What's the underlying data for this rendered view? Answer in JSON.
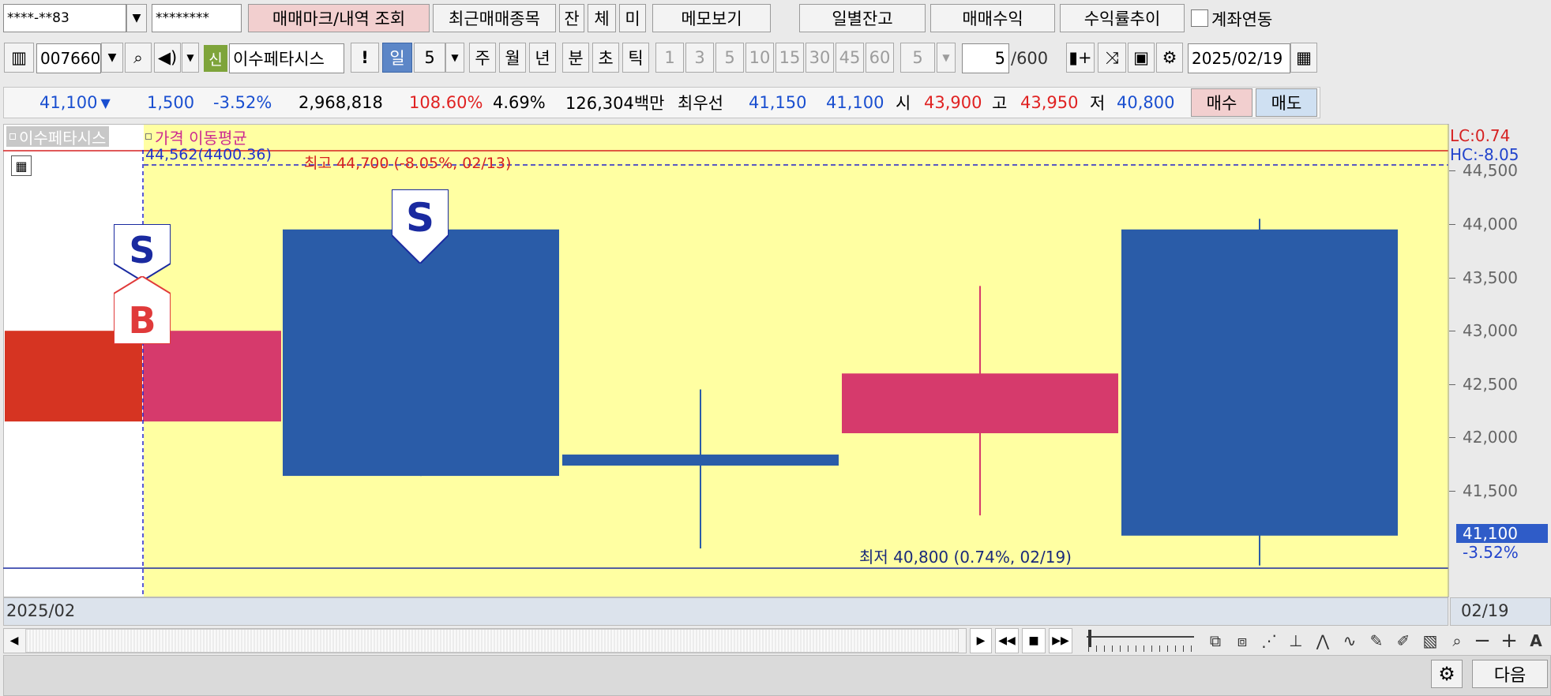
{
  "top": {
    "account": "****-**83",
    "password": "********",
    "btn_mark": "매매마크/내역 조회",
    "btn_recent": "최근매매종목",
    "btn_jan": "잔",
    "btn_che": "체",
    "btn_mi": "미",
    "btn_memo": "메모보기",
    "btn_daily": "일별잔고",
    "btn_profit": "매매수익",
    "btn_trend": "수익률추이",
    "link_label": "계좌연동"
  },
  "toolbar": {
    "code": "007660",
    "credit_badge": "신",
    "stock_name": "이수페타시스",
    "bang": "!",
    "periods": [
      "일",
      "5",
      "주",
      "월",
      "년",
      "분",
      "초",
      "틱"
    ],
    "minutes": [
      "1",
      "3",
      "5",
      "10",
      "15",
      "30",
      "45",
      "60"
    ],
    "interval": "5",
    "count": "5",
    "count_max": "/600",
    "date": "2025/02/19"
  },
  "quote": {
    "price": "41,100",
    "change": "1,500",
    "change_pct": "-3.52%",
    "volume": "2,968,818",
    "vol_ratio": "108.60%",
    "turnover": "4.69%",
    "amount": "126,304백만",
    "best_label": "최우선",
    "best_ask": "41,150",
    "best_bid": "41,100",
    "open_label": "시",
    "open": "43,900",
    "high_label": "고",
    "high": "43,950",
    "low_label": "저",
    "low": "40,800",
    "buy": "매수",
    "sell": "매도"
  },
  "chart": {
    "tab_name": "이수페타시스",
    "tab_ma": "가격 이동평균",
    "ma_value": "44,562(4400.36)",
    "high_note": "최고 44,700 (-8.05%, 02/13)",
    "low_note": "최저 40,800 (0.74%, 02/19)",
    "lc": "LC:0.74",
    "hc": "HC:-8.05",
    "yticks": [
      "44,500",
      "44,000",
      "43,500",
      "43,000",
      "42,500",
      "42,000",
      "41,500"
    ],
    "current_price": "41,100",
    "current_pct": "-3.52%",
    "marker_s": "S",
    "marker_b": "B",
    "x_start": "2025/02",
    "x_end": "02/19",
    "colors": {
      "up": "#d63a6c",
      "down": "#2a5ca8",
      "prev_up": "#d63422",
      "bg": "#ffffa2"
    }
  },
  "bottom": {
    "next": "다음"
  }
}
